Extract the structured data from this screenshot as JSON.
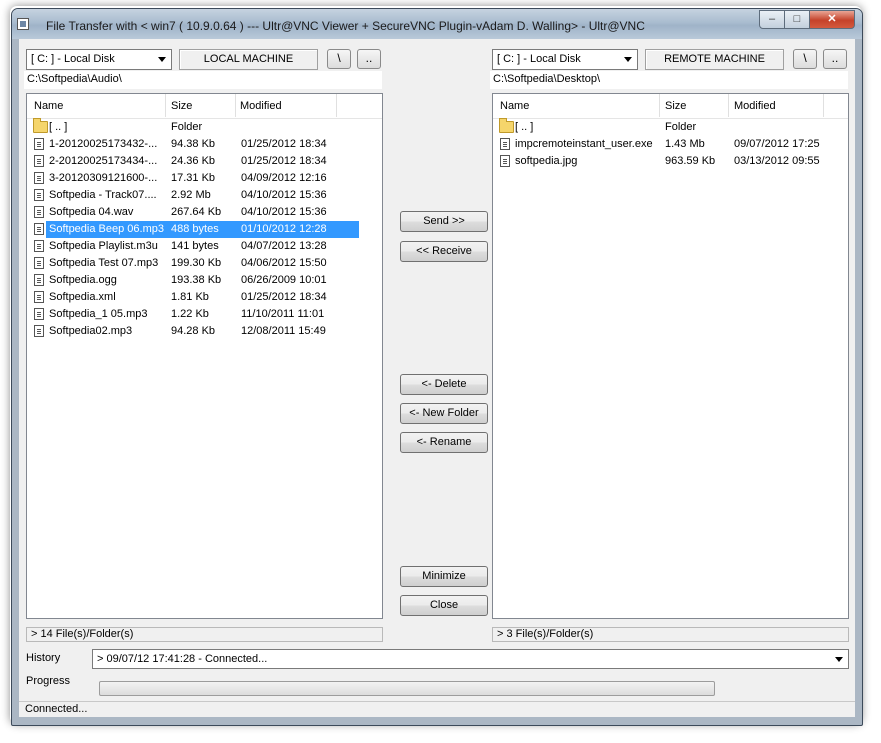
{
  "window": {
    "title": "File Transfer with < win7 ( 10.9.0.64 ) --- Ultr@VNC Viewer + SecureVNC Plugin-vAdam D. Walling>  - Ultr@VNC",
    "minimize_glyph": "–",
    "maximize_glyph": "□",
    "close_glyph": "✕"
  },
  "local": {
    "drive": "[ C: ] - Local Disk",
    "machine_label": "LOCAL MACHINE",
    "root_btn": "\\",
    "up_btn": "..",
    "path": "C:\\Softpedia\\Audio\\",
    "columns": [
      "Name",
      "Size",
      "Modified"
    ],
    "rows": [
      {
        "name": "[ .. ]",
        "size": "Folder",
        "modified": "",
        "icon": "folder-icon"
      },
      {
        "name": "1-20120025173432-...",
        "size": "94.38 Kb",
        "modified": "01/25/2012 18:34",
        "icon": "file-icon"
      },
      {
        "name": "2-20120025173434-...",
        "size": "24.36 Kb",
        "modified": "01/25/2012 18:34",
        "icon": "file-icon"
      },
      {
        "name": "3-20120309121600-...",
        "size": "17.31 Kb",
        "modified": "04/09/2012 12:16",
        "icon": "file-icon"
      },
      {
        "name": "Softpedia - Track07....",
        "size": "2.92 Mb",
        "modified": "04/10/2012 15:36",
        "icon": "file-icon"
      },
      {
        "name": "Softpedia 04.wav",
        "size": "267.64 Kb",
        "modified": "04/10/2012 15:36",
        "icon": "file-icon"
      },
      {
        "name": "Softpedia Beep 06.mp3",
        "size": "488 bytes",
        "modified": "01/10/2012 12:28",
        "icon": "file-icon",
        "selected": true
      },
      {
        "name": "Softpedia Playlist.m3u",
        "size": "141 bytes",
        "modified": "04/07/2012 13:28",
        "icon": "file-icon"
      },
      {
        "name": "Softpedia Test 07.mp3",
        "size": "199.30 Kb",
        "modified": "04/06/2012 15:50",
        "icon": "file-icon"
      },
      {
        "name": "Softpedia.ogg",
        "size": "193.38 Kb",
        "modified": "06/26/2009 10:01",
        "icon": "file-icon"
      },
      {
        "name": "Softpedia.xml",
        "size": "1.81 Kb",
        "modified": "01/25/2012 18:34",
        "icon": "file-icon"
      },
      {
        "name": "Softpedia_1 05.mp3",
        "size": "1.22 Kb",
        "modified": "11/10/2011 11:01",
        "icon": "file-icon"
      },
      {
        "name": "Softpedia02.mp3",
        "size": "94.28 Kb",
        "modified": "12/08/2011 15:49",
        "icon": "file-icon"
      }
    ],
    "status": "> 14 File(s)/Folder(s)"
  },
  "remote": {
    "drive": "[ C: ] - Local Disk",
    "machine_label": "REMOTE MACHINE",
    "root_btn": "\\",
    "up_btn": "..",
    "path": "C:\\Softpedia\\Desktop\\",
    "columns": [
      "Name",
      "Size",
      "Modified"
    ],
    "rows": [
      {
        "name": "[ .. ]",
        "size": "Folder",
        "modified": "",
        "icon": "folder-icon"
      },
      {
        "name": "impcremoteinstant_user.exe",
        "size": "1.43 Mb",
        "modified": "09/07/2012 17:25",
        "icon": "file-icon"
      },
      {
        "name": "softpedia.jpg",
        "size": "963.59 Kb",
        "modified": "03/13/2012 09:55",
        "icon": "file-icon"
      }
    ],
    "status": "> 3 File(s)/Folder(s)"
  },
  "actions": {
    "send": "Send >>",
    "receive": "<< Receive",
    "delete": "<- Delete",
    "new_folder": "<- New Folder",
    "rename": "<- Rename",
    "minimize": "Minimize",
    "close": "Close"
  },
  "history": {
    "label": "History",
    "value": "> 09/07/12 17:41:28 -  Connected..."
  },
  "progress": {
    "label": "Progress",
    "value": 0
  },
  "statusbar": "Connected..."
}
